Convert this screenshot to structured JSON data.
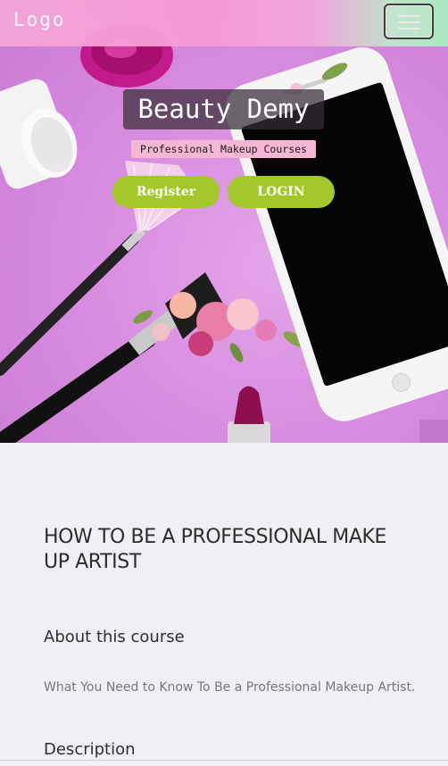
{
  "navbar": {
    "logo": "Logo",
    "menu_icon": "hamburger-menu-icon"
  },
  "hero": {
    "title": "Beauty Demy",
    "subtitle": "Professional Makeup Courses",
    "register_label": "Register",
    "login_label": "LOGIN",
    "button_color": "#a3c82a",
    "background_color": "#d88ee0"
  },
  "course": {
    "title": "HOW TO BE A PROFESSIONAL MAKE UP ARTIST",
    "about_heading": "About this course",
    "about_text": "What You Need to Know To Be a Professional Makeup Artist.",
    "description_heading": "Description"
  }
}
